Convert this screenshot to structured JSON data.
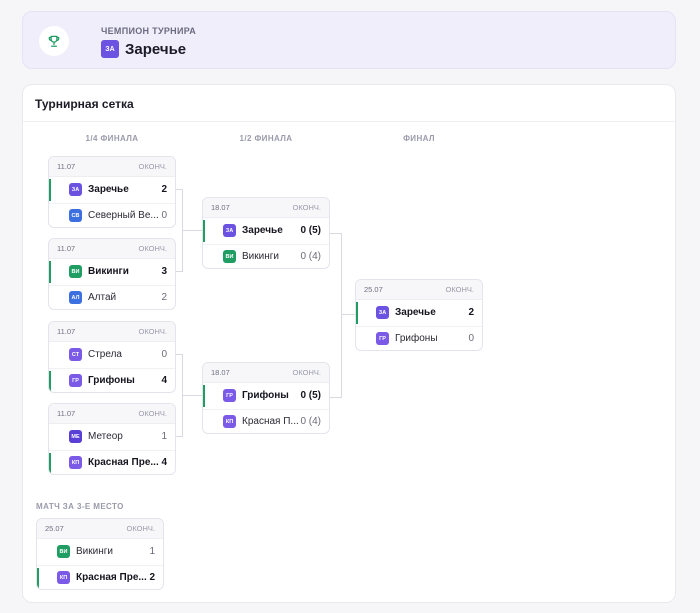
{
  "champion": {
    "label": "ЧЕМПИОН ТУРНИРА",
    "badge": "ЗА",
    "name": "Заречье"
  },
  "bracket": {
    "title": "Турнирная сетка",
    "rounds": [
      "1/4 ФИНАЛА",
      "1/2 ФИНАЛА",
      "ФИНАЛ"
    ],
    "third_place_label": "МАТЧ ЗА 3-Е МЕСТО",
    "matches": {
      "qf1": {
        "date": "11.07",
        "status": "ОКОНЧ.",
        "teams": [
          {
            "badge": "ЗА",
            "name": "Заречье",
            "score": "2",
            "win": true,
            "color": "#6b52e0"
          },
          {
            "badge": "СВ",
            "name": "Северный Ве...",
            "score": "0",
            "win": false,
            "color": "#3c6fe0"
          }
        ]
      },
      "qf2": {
        "date": "11.07",
        "status": "ОКОНЧ.",
        "teams": [
          {
            "badge": "ВИ",
            "name": "Викинги",
            "score": "3",
            "win": true,
            "color": "#1f9d63"
          },
          {
            "badge": "АЛ",
            "name": "Алтай",
            "score": "2",
            "win": false,
            "color": "#3c6fe0"
          }
        ]
      },
      "qf3": {
        "date": "11.07",
        "status": "ОКОНЧ.",
        "teams": [
          {
            "badge": "СТ",
            "name": "Стрела",
            "score": "0",
            "win": false,
            "color": "#7a5ae6"
          },
          {
            "badge": "ГР",
            "name": "Грифоны",
            "score": "4",
            "win": true,
            "color": "#7a5ae6"
          }
        ]
      },
      "qf4": {
        "date": "11.07",
        "status": "ОКОНЧ.",
        "teams": [
          {
            "badge": "МЕ",
            "name": "Метеор",
            "score": "1",
            "win": false,
            "color": "#5a3fd6"
          },
          {
            "badge": "КП",
            "name": "Красная Пре...",
            "score": "4",
            "win": true,
            "color": "#7a5ae6"
          }
        ]
      },
      "sf1": {
        "date": "18.07",
        "status": "ОКОНЧ.",
        "teams": [
          {
            "badge": "ЗА",
            "name": "Заречье",
            "score": "0 (5)",
            "win": true,
            "color": "#6b52e0"
          },
          {
            "badge": "ВИ",
            "name": "Викинги",
            "score": "0 (4)",
            "win": false,
            "color": "#1f9d63"
          }
        ]
      },
      "sf2": {
        "date": "18.07",
        "status": "ОКОНЧ.",
        "teams": [
          {
            "badge": "ГР",
            "name": "Грифоны",
            "score": "0 (5)",
            "win": true,
            "color": "#7a5ae6"
          },
          {
            "badge": "КП",
            "name": "Красная П...",
            "score": "0 (4)",
            "win": false,
            "color": "#7a5ae6"
          }
        ]
      },
      "final": {
        "date": "25.07",
        "status": "ОКОНЧ.",
        "teams": [
          {
            "badge": "ЗА",
            "name": "Заречье",
            "score": "2",
            "win": true,
            "color": "#6b52e0"
          },
          {
            "badge": "ГР",
            "name": "Грифоны",
            "score": "0",
            "win": false,
            "color": "#7a5ae6"
          }
        ]
      },
      "third": {
        "date": "25.07",
        "status": "ОКОНЧ.",
        "teams": [
          {
            "badge": "ВИ",
            "name": "Викинги",
            "score": "1",
            "win": false,
            "color": "#1f9d63"
          },
          {
            "badge": "КП",
            "name": "Красная Пре...",
            "score": "2",
            "win": true,
            "color": "#7a5ae6"
          }
        ]
      }
    }
  },
  "colors": {
    "accent": "#6b52e0",
    "win": "#1f9d63",
    "champ_bg": "#f1eefb"
  },
  "icons": {
    "trophy": "trophy-icon"
  }
}
